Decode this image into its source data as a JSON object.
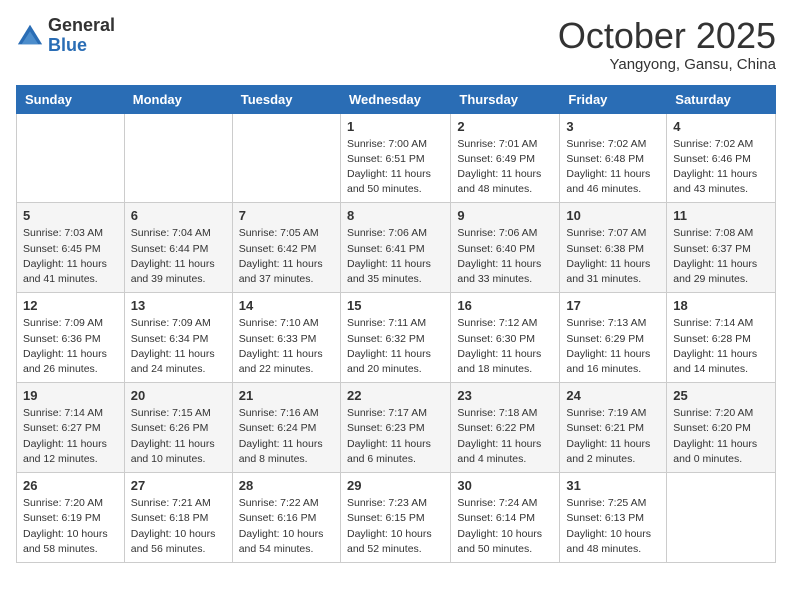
{
  "logo": {
    "general": "General",
    "blue": "Blue"
  },
  "title": "October 2025",
  "subtitle": "Yangyong, Gansu, China",
  "weekdays": [
    "Sunday",
    "Monday",
    "Tuesday",
    "Wednesday",
    "Thursday",
    "Friday",
    "Saturday"
  ],
  "weeks": [
    [
      {
        "day": "",
        "info": ""
      },
      {
        "day": "",
        "info": ""
      },
      {
        "day": "",
        "info": ""
      },
      {
        "day": "1",
        "info": "Sunrise: 7:00 AM\nSunset: 6:51 PM\nDaylight: 11 hours\nand 50 minutes."
      },
      {
        "day": "2",
        "info": "Sunrise: 7:01 AM\nSunset: 6:49 PM\nDaylight: 11 hours\nand 48 minutes."
      },
      {
        "day": "3",
        "info": "Sunrise: 7:02 AM\nSunset: 6:48 PM\nDaylight: 11 hours\nand 46 minutes."
      },
      {
        "day": "4",
        "info": "Sunrise: 7:02 AM\nSunset: 6:46 PM\nDaylight: 11 hours\nand 43 minutes."
      }
    ],
    [
      {
        "day": "5",
        "info": "Sunrise: 7:03 AM\nSunset: 6:45 PM\nDaylight: 11 hours\nand 41 minutes."
      },
      {
        "day": "6",
        "info": "Sunrise: 7:04 AM\nSunset: 6:44 PM\nDaylight: 11 hours\nand 39 minutes."
      },
      {
        "day": "7",
        "info": "Sunrise: 7:05 AM\nSunset: 6:42 PM\nDaylight: 11 hours\nand 37 minutes."
      },
      {
        "day": "8",
        "info": "Sunrise: 7:06 AM\nSunset: 6:41 PM\nDaylight: 11 hours\nand 35 minutes."
      },
      {
        "day": "9",
        "info": "Sunrise: 7:06 AM\nSunset: 6:40 PM\nDaylight: 11 hours\nand 33 minutes."
      },
      {
        "day": "10",
        "info": "Sunrise: 7:07 AM\nSunset: 6:38 PM\nDaylight: 11 hours\nand 31 minutes."
      },
      {
        "day": "11",
        "info": "Sunrise: 7:08 AM\nSunset: 6:37 PM\nDaylight: 11 hours\nand 29 minutes."
      }
    ],
    [
      {
        "day": "12",
        "info": "Sunrise: 7:09 AM\nSunset: 6:36 PM\nDaylight: 11 hours\nand 26 minutes."
      },
      {
        "day": "13",
        "info": "Sunrise: 7:09 AM\nSunset: 6:34 PM\nDaylight: 11 hours\nand 24 minutes."
      },
      {
        "day": "14",
        "info": "Sunrise: 7:10 AM\nSunset: 6:33 PM\nDaylight: 11 hours\nand 22 minutes."
      },
      {
        "day": "15",
        "info": "Sunrise: 7:11 AM\nSunset: 6:32 PM\nDaylight: 11 hours\nand 20 minutes."
      },
      {
        "day": "16",
        "info": "Sunrise: 7:12 AM\nSunset: 6:30 PM\nDaylight: 11 hours\nand 18 minutes."
      },
      {
        "day": "17",
        "info": "Sunrise: 7:13 AM\nSunset: 6:29 PM\nDaylight: 11 hours\nand 16 minutes."
      },
      {
        "day": "18",
        "info": "Sunrise: 7:14 AM\nSunset: 6:28 PM\nDaylight: 11 hours\nand 14 minutes."
      }
    ],
    [
      {
        "day": "19",
        "info": "Sunrise: 7:14 AM\nSunset: 6:27 PM\nDaylight: 11 hours\nand 12 minutes."
      },
      {
        "day": "20",
        "info": "Sunrise: 7:15 AM\nSunset: 6:26 PM\nDaylight: 11 hours\nand 10 minutes."
      },
      {
        "day": "21",
        "info": "Sunrise: 7:16 AM\nSunset: 6:24 PM\nDaylight: 11 hours\nand 8 minutes."
      },
      {
        "day": "22",
        "info": "Sunrise: 7:17 AM\nSunset: 6:23 PM\nDaylight: 11 hours\nand 6 minutes."
      },
      {
        "day": "23",
        "info": "Sunrise: 7:18 AM\nSunset: 6:22 PM\nDaylight: 11 hours\nand 4 minutes."
      },
      {
        "day": "24",
        "info": "Sunrise: 7:19 AM\nSunset: 6:21 PM\nDaylight: 11 hours\nand 2 minutes."
      },
      {
        "day": "25",
        "info": "Sunrise: 7:20 AM\nSunset: 6:20 PM\nDaylight: 11 hours\nand 0 minutes."
      }
    ],
    [
      {
        "day": "26",
        "info": "Sunrise: 7:20 AM\nSunset: 6:19 PM\nDaylight: 10 hours\nand 58 minutes."
      },
      {
        "day": "27",
        "info": "Sunrise: 7:21 AM\nSunset: 6:18 PM\nDaylight: 10 hours\nand 56 minutes."
      },
      {
        "day": "28",
        "info": "Sunrise: 7:22 AM\nSunset: 6:16 PM\nDaylight: 10 hours\nand 54 minutes."
      },
      {
        "day": "29",
        "info": "Sunrise: 7:23 AM\nSunset: 6:15 PM\nDaylight: 10 hours\nand 52 minutes."
      },
      {
        "day": "30",
        "info": "Sunrise: 7:24 AM\nSunset: 6:14 PM\nDaylight: 10 hours\nand 50 minutes."
      },
      {
        "day": "31",
        "info": "Sunrise: 7:25 AM\nSunset: 6:13 PM\nDaylight: 10 hours\nand 48 minutes."
      },
      {
        "day": "",
        "info": ""
      }
    ]
  ]
}
